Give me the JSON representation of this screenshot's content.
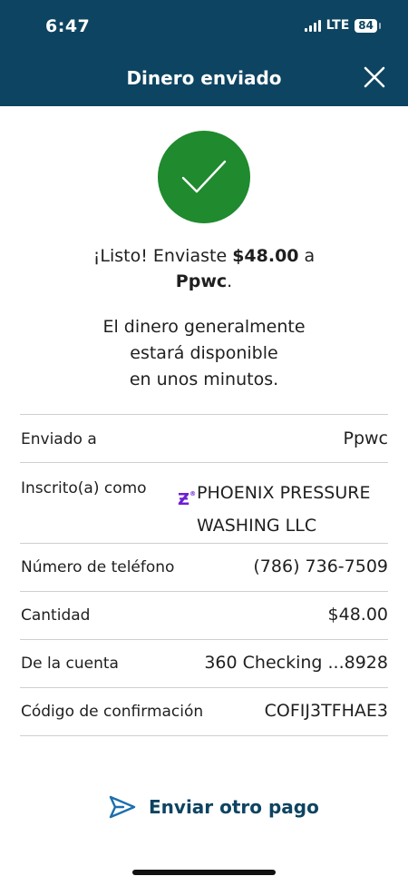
{
  "status_bar": {
    "time": "6:47",
    "network": "LTE",
    "battery": "84"
  },
  "header": {
    "title": "Dinero enviado",
    "close_icon": "close-icon"
  },
  "success": {
    "icon": "checkmark-icon",
    "prefix": "¡Listo! Enviaste ",
    "amount": "$48.00",
    "middle": " a",
    "recipient": "Ppwc",
    "suffix": ".",
    "info_lines": [
      "El dinero generalmente",
      "estará disponible",
      "en unos minutos."
    ]
  },
  "details": [
    {
      "label": "Enviado a",
      "value": "Ppwc"
    },
    {
      "label": "Inscrito(a) como",
      "value_lines": [
        "PHOENIX PRESSURE",
        "WASHING LLC"
      ],
      "logo": "zelle-icon"
    },
    {
      "label": "Número de teléfono",
      "value": "(786) 736-7509"
    },
    {
      "label": "Cantidad",
      "value": "$48.00"
    },
    {
      "label": "De la cuenta",
      "value": "360 Checking ...8928"
    },
    {
      "label": "Código de confirmación",
      "value": "COFIJ3TFHAE3"
    }
  ],
  "actions": {
    "send_again_label": "Enviar otro pago",
    "send_icon": "send-icon"
  },
  "colors": {
    "header_bg": "#0d4461",
    "success_green": "#1f8a2e",
    "zelle_purple": "#6d1ed4"
  }
}
